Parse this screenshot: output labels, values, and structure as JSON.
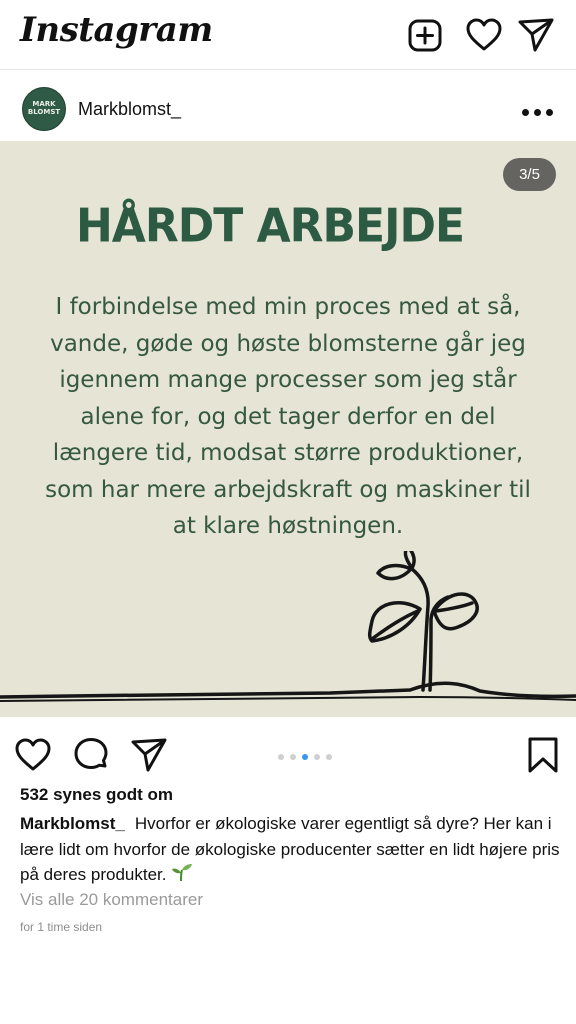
{
  "app": {
    "logo_text": "Instagram"
  },
  "post": {
    "username": "Markblomst_",
    "avatar_text": "MARK\nBLOMST",
    "slide_counter": "3/5",
    "slide_index": 3,
    "slide_total": 5,
    "image": {
      "headline": "HÅRDT ARBEJDE",
      "body": "I forbindelse med min proces med at så, vande, gøde og høste blomsterne går jeg igennem mange processer som jeg står alene for, og det tager derfor en del længere tid, modsat større produktioner, som har mere arbejdskraft og maskiner til at klare høstningen.",
      "background_color": "#e5e4d5",
      "text_color": "#2c5a42"
    },
    "likes": "532 synes godt om",
    "caption_user": "Markblomst_",
    "caption_text": "Hvorfor er økologiske varer egentligt så dyre? Her kan i lære lidt om hvorfor de økologiske producenter sætter en lidt højere pris på deres produkter.",
    "caption_emoji": "seedling-icon",
    "view_comments": "Vis alle 20 kommentarer",
    "time": "for 1 time siden"
  },
  "icons": {
    "new_post": "plus-square-icon",
    "activity": "heart-icon",
    "direct": "paper-plane-icon",
    "more": "more-horizontal-icon",
    "like": "heart-icon",
    "comment": "comment-icon",
    "share": "paper-plane-icon",
    "save": "bookmark-icon"
  },
  "colors": {
    "accent_dot": "#3897f0",
    "inactive_dot": "#cfcfcf",
    "brand_green": "#2c5a42"
  }
}
